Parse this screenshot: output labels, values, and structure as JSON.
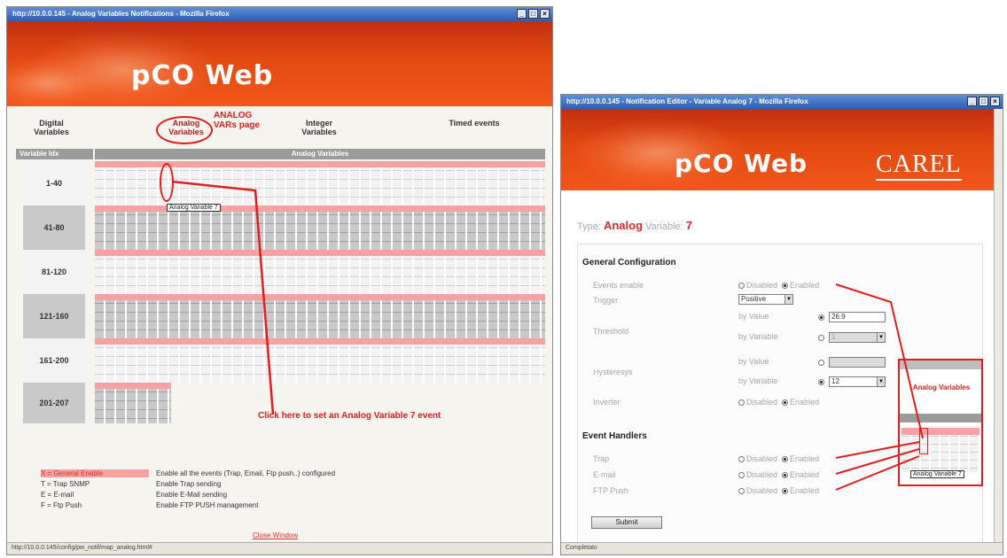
{
  "left": {
    "title": "http://10.0.0.145 - Analog Variables Notifications - Mozilla Firefox",
    "logo": "pCO Web",
    "nav": [
      "Digital Variables",
      "Analog Variables",
      "Integer Variables",
      "Timed events"
    ],
    "annotation_top": "ANALOG VARs page",
    "header_left": "Variable Idx",
    "header_right": "Analog Variables",
    "rows": [
      "1-40",
      "41-80",
      "81-120",
      "121-160",
      "161-200",
      "201-207"
    ],
    "tooltip": "Analog Variable 7",
    "annotation_click": "Click here to set an Analog Variable 7 event",
    "legend": [
      {
        "key": "X = General Enable",
        "desc": "Enable all the events (Trap, Email, Ftp push..) configured"
      },
      {
        "key": "T = Trap SNMP",
        "desc": "Enable Trap sending"
      },
      {
        "key": "E = E-mail",
        "desc": "Enable E-Mail sending"
      },
      {
        "key": "F = Ftp Push",
        "desc": "Enable FTP PUSH management"
      }
    ],
    "close": "Close Window",
    "status": "http://10.0.0.145/config/pw_notif/map_analog.html#"
  },
  "right": {
    "title": "http://10.0.0.145 - Notification Editor - Variable Analog 7 - Mozilla Firefox",
    "logo": "pCO Web",
    "brand": "CAREL",
    "type_label": "Type:",
    "type_value": "Analog",
    "var_label": "Variable:",
    "var_value": "7",
    "general": "General Configuration",
    "events_enable": "Events enable",
    "trigger": "Trigger",
    "trigger_value": "Positive",
    "threshold": "Threshold",
    "hysteresis": "Hysteresys",
    "inverter": "Inverter",
    "by_value": "by Value",
    "by_variable": "by Variable",
    "threshold_value": "26.9",
    "threshold_var": "1",
    "hyst_var": "12",
    "disabled": "Disabled",
    "enabled": "Enabled",
    "handlers": "Event Handlers",
    "trap": "Trap",
    "email": "E-mail",
    "ftp": "FTP Push",
    "submit": "Submit",
    "inset_label": "Analog Variables",
    "inset_tooltip": "Analog Variable 7",
    "status": "Completato"
  }
}
